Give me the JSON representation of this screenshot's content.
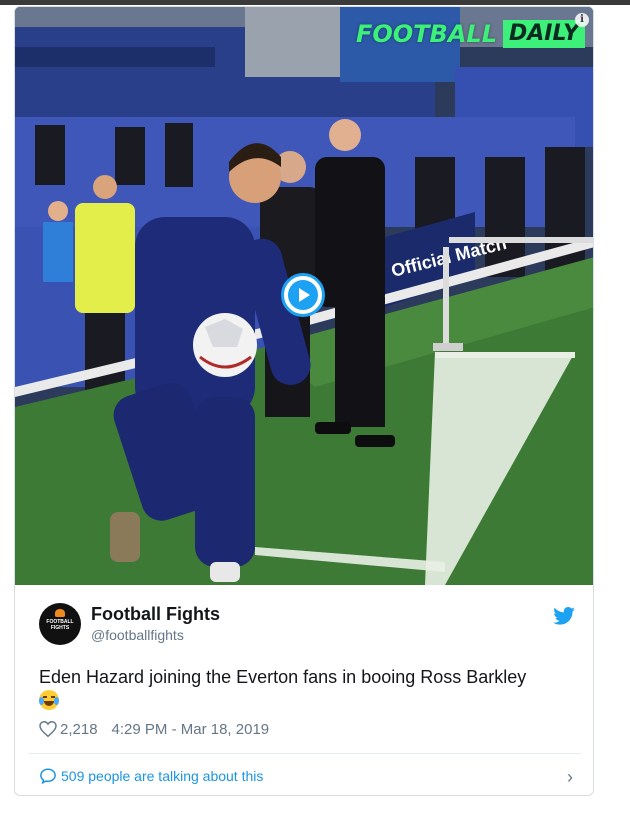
{
  "video": {
    "watermark_part1": "FOOTBALL",
    "watermark_part2": "DAILY",
    "pitch_banner_text": "Official Match"
  },
  "author": {
    "display_name": "Football Fights",
    "handle": "@footballfights",
    "avatar_text": "FOOTBALL FIGHTS"
  },
  "tweet": {
    "text": "Eden Hazard joining the Everton fans in booing Ross Barkley",
    "emoji": "face-with-tears-of-joy-icon"
  },
  "meta": {
    "likes": "2,218",
    "timestamp": "4:29 PM - Mar 18, 2019"
  },
  "conversation": {
    "label": "509 people are talking about this"
  },
  "colors": {
    "twitter_blue": "#1da1f2",
    "link_blue": "#1b95e0",
    "pitch_green": "#3d7a35",
    "watermark_green": "#3cf07a"
  }
}
